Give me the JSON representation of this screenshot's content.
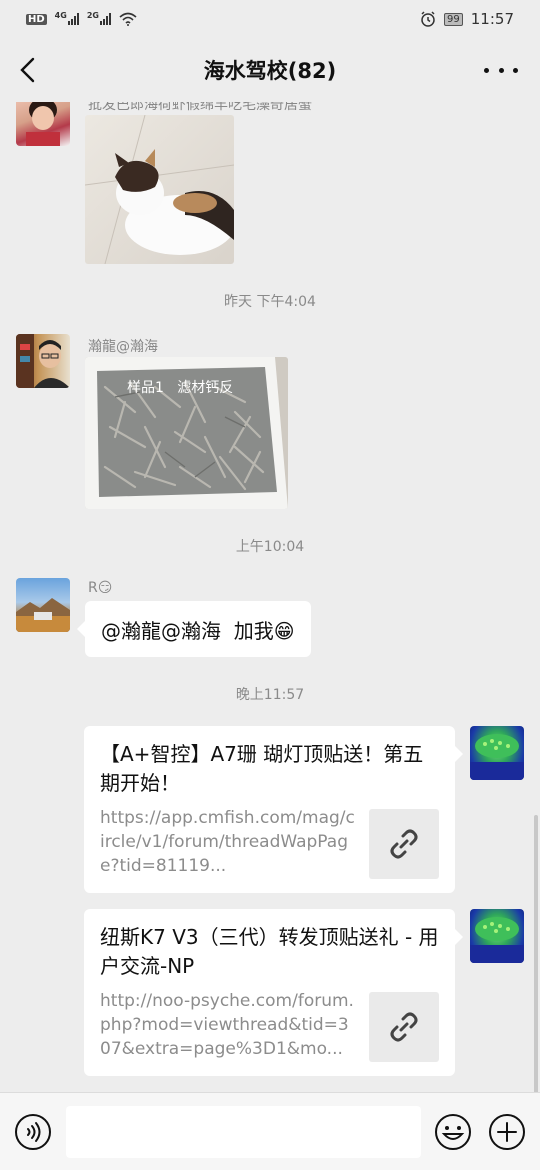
{
  "status_bar": {
    "left_label": "HD",
    "signal_1": "4G",
    "signal_2": "2G",
    "battery": "99",
    "time": "11:57"
  },
  "header": {
    "title": "海水驾校(82)"
  },
  "messages": {
    "top_caption": "批发巴郎海荷虾假绵羊吃毛藻奇居蟹",
    "time_1": "昨天 下午4:04",
    "sender_2": "瀚龍@瀚海",
    "image_2_caption": "样品1   滤材钙反",
    "time_2": "上午10:04",
    "sender_3": "R😏",
    "text_3": "@瀚龍@瀚海  加我😁",
    "time_3": "晚上11:57"
  },
  "cards": [
    {
      "title": "【A+智控】A7珊 瑚灯顶贴送！第五期开始！",
      "url": "https://app.cmfish.com/mag/circle/v1/forum/threadWapPage?tid=81119..."
    },
    {
      "title": "纽斯K7 V3（三代）转发顶贴送礼 - 用户交流-NP",
      "url": "http://noo-psyche.com/forum.php?mod=viewthread&tid=307&extra=page%3D1&mo..."
    }
  ],
  "icons": {
    "back": "chevron-left-icon",
    "more": "more-dots-icon",
    "link": "link-icon",
    "voice": "voice-icon",
    "emoji": "emoji-icon",
    "plus": "plus-icon"
  },
  "colors": {
    "background": "#ededed",
    "bubble": "#ffffff",
    "link_thumb": "#eaeaea"
  }
}
